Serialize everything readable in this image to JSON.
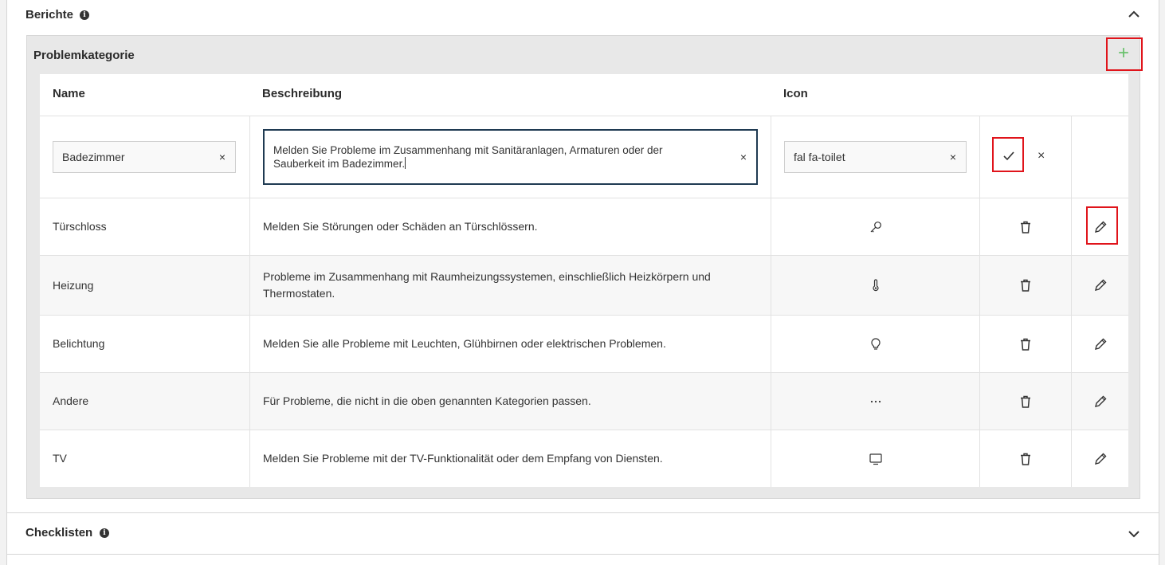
{
  "sections": {
    "berichte": {
      "title": "Berichte",
      "expanded": true
    },
    "checklisten": {
      "title": "Checklisten",
      "expanded": false
    }
  },
  "panel": {
    "title": "Problemkategorie",
    "add_label": "+"
  },
  "table": {
    "headers": {
      "name": "Name",
      "description": "Beschreibung",
      "icon": "Icon"
    },
    "edit_row": {
      "name": "Badezimmer",
      "description_line1": "Melden Sie Probleme im Zusammenhang mit Sanitäranlagen, Armaturen oder der",
      "description_line2": "Sauberkeit im Badezimmer.",
      "icon": "fal fa-toilet",
      "clear": "×",
      "cancel": "×"
    },
    "rows": [
      {
        "name": "Türschloss",
        "description": "Melden Sie Störungen oder Schäden an Türschlössern.",
        "description2": "",
        "icon": "key-icon"
      },
      {
        "name": "Heizung",
        "description": "Probleme im Zusammenhang mit Raumheizungssystemen, einschließlich Heizkörpern und",
        "description2": "Thermostaten.",
        "icon": "thermometer-icon"
      },
      {
        "name": "Belichtung",
        "description": "Melden Sie alle Probleme mit Leuchten, Glühbirnen oder elektrischen Problemen.",
        "description2": "",
        "icon": "lightbulb-icon"
      },
      {
        "name": "Andere",
        "description": "Für Probleme, die nicht in die oben genannten Kategorien passen.",
        "description2": "",
        "icon": "ellipsis-icon"
      },
      {
        "name": "TV",
        "description": "Melden Sie Probleme mit der TV-Funktionalität oder dem Empfang von Diensten.",
        "description2": "",
        "icon": "tv-icon"
      }
    ]
  },
  "colors": {
    "highlight": "#e0141b",
    "add_green": "#69c16c",
    "focus_border": "#1f3a52"
  }
}
